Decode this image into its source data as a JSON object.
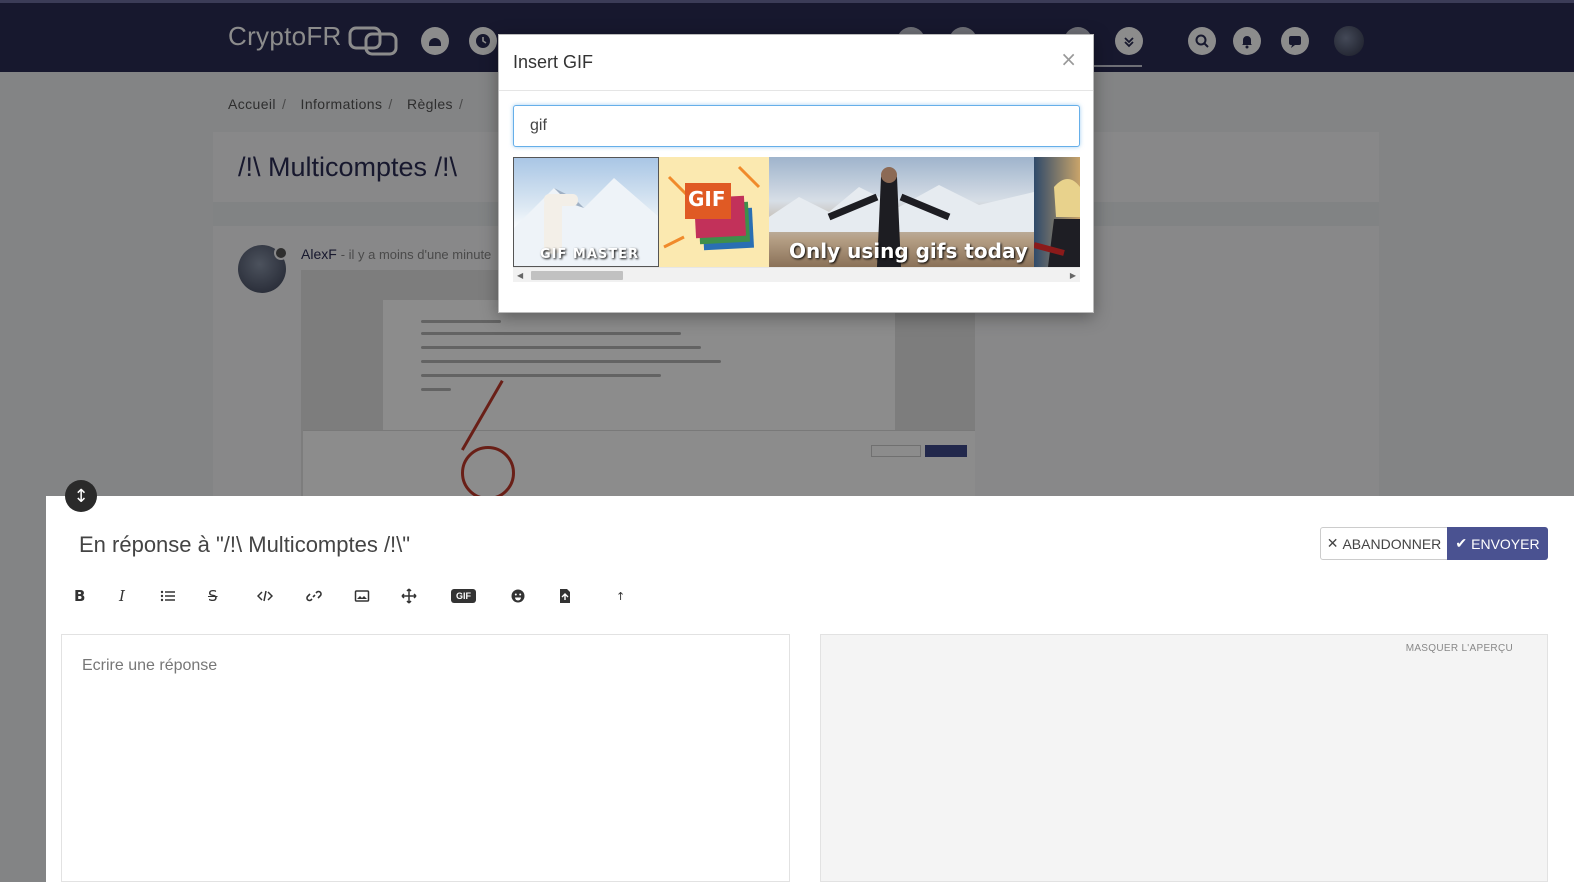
{
  "app": {
    "logo": "CryptoFR"
  },
  "breadcrumb": [
    "Accueil",
    "Informations",
    "Règles"
  ],
  "topic": {
    "title": "/!\\ Multicomptes /!\\"
  },
  "post": {
    "author": "AlexF",
    "time": "- il y a moins d'une minute"
  },
  "composer": {
    "reply_title": "En réponse à \"/!\\ Multicomptes /!\\\"",
    "cancel_label": "ABANDONNER",
    "send_label": "ENVOYER",
    "placeholder": "Ecrire une réponse",
    "hide_preview": "MASQUER L'APERÇU",
    "gif_label": "GIF"
  },
  "modal": {
    "title": "Insert GIF",
    "close": "×",
    "search_value": "gif",
    "gifs": [
      {
        "name": "gif-llama",
        "caption": "GIF MASTER"
      },
      {
        "name": "gif-logo",
        "caption": "GIF"
      },
      {
        "name": "gif-suit-man",
        "caption": "Only using gifs today"
      },
      {
        "name": "gif-woman",
        "caption": ""
      }
    ]
  },
  "colors": {
    "navbar": "#2b2d54",
    "accent": "#4a5291",
    "focus": "#66afe9"
  }
}
